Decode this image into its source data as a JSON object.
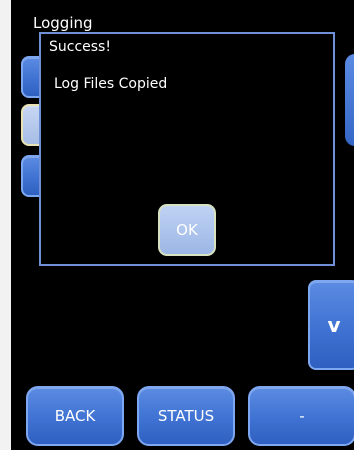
{
  "header": {
    "title": "Logging"
  },
  "dialog": {
    "title": "Success!",
    "message": "Log Files Copied",
    "ok_label": "OK"
  },
  "side_buttons": [
    {
      "label": ""
    },
    {
      "label": ""
    },
    {
      "label": ""
    }
  ],
  "scroll": {
    "down_label": "v"
  },
  "footer": {
    "back_label": "BACK",
    "status_label": "STATUS",
    "dash_label": "-"
  },
  "colors": {
    "button_blue": "#4a7bd9",
    "dialog_border": "#6f8fd6",
    "ok_button": "#b3c8ee"
  }
}
